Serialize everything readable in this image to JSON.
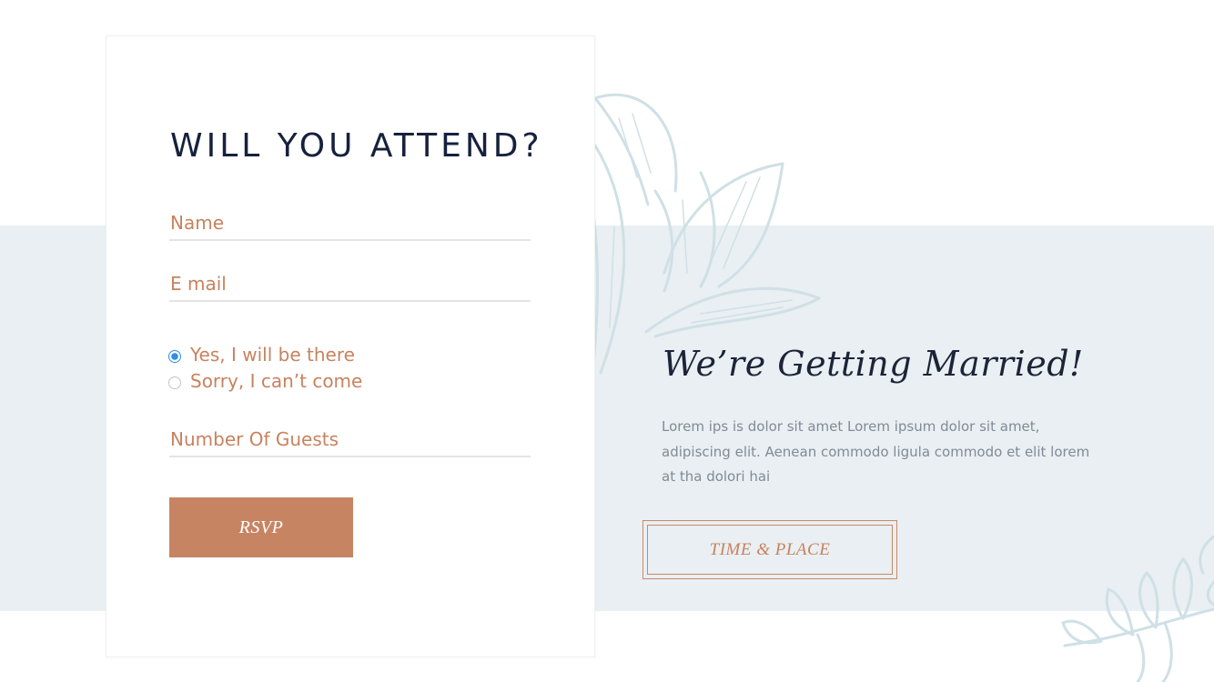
{
  "rsvp_form": {
    "title": "WILL YOU ATTEND?",
    "name_placeholder": "Name",
    "email_placeholder": "E mail",
    "attendance_options": [
      {
        "label": "Yes, I will be there",
        "selected": true
      },
      {
        "label": "Sorry, I can’t come",
        "selected": false
      }
    ],
    "guests_placeholder": "Number Of Guests",
    "submit_label": "RSVP"
  },
  "announcement": {
    "headline": "We’re Getting Married!",
    "body": "Lorem ips is dolor sit amet Lorem ipsum dolor sit amet, adipiscing elit. Aenean commodo ligula commodo et elit lorem at tha dolori hai",
    "button_label": "TIME & PLACE"
  },
  "colors": {
    "accent": "#c78463",
    "accent_text": "#c8825e",
    "heading": "#16213d",
    "band_background": "#e9eff2",
    "floral_line": "#cfe0e6",
    "radio_selected": "#2f8de8"
  },
  "icons": {
    "large_floral": "flower-illustration",
    "small_floral": "leaf-branch-illustration"
  }
}
